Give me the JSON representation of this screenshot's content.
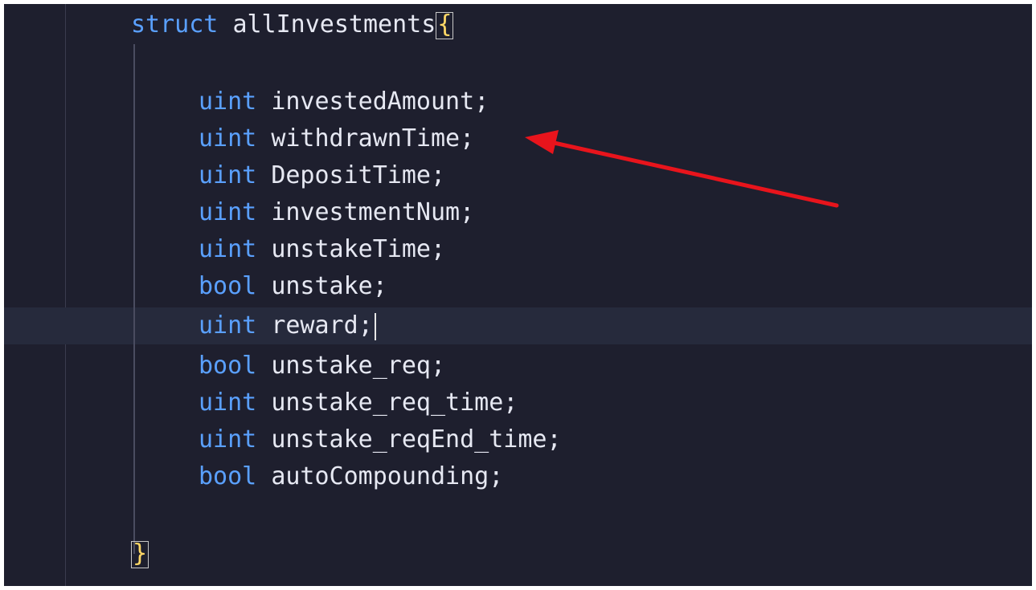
{
  "struct": {
    "keyword": "struct",
    "name": "allInvestments",
    "open_brace": "{",
    "close_brace": "}"
  },
  "fields": [
    {
      "type": "uint",
      "name": "investedAmount",
      "semi": ";"
    },
    {
      "type": "uint",
      "name": "withdrawnTime",
      "semi": ";"
    },
    {
      "type": "uint",
      "name": "DepositTime",
      "semi": ";"
    },
    {
      "type": "uint",
      "name": "investmentNum",
      "semi": ";"
    },
    {
      "type": "uint",
      "name": "unstakeTime",
      "semi": ";"
    },
    {
      "type": "bool",
      "name": "unstake",
      "semi": ";"
    },
    {
      "type": "uint",
      "name": "reward",
      "semi": ";"
    },
    {
      "type": "bool",
      "name": "unstake_req",
      "semi": ";"
    },
    {
      "type": "uint",
      "name": "unstake_req_time",
      "semi": ";"
    },
    {
      "type": "uint",
      "name": "unstake_reqEnd_time",
      "semi": ";"
    },
    {
      "type": "bool",
      "name": "autoCompounding",
      "semi": ";"
    }
  ],
  "annotation": {
    "arrow_color": "#e8141c",
    "points_to": "withdrawnTime"
  },
  "colors": {
    "background": "#1e1f2e",
    "keyword": "#5aa0ff",
    "identifier": "#e6e8f2"
  }
}
